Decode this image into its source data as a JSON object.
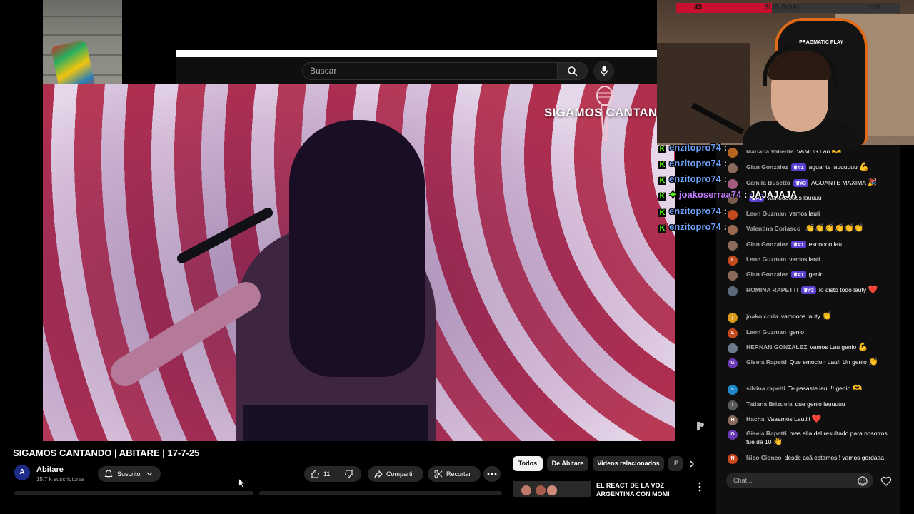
{
  "header": {
    "search_placeholder": "Buscar"
  },
  "video": {
    "overlay_title": "SIGAMOS CANTAN",
    "title": "SIGAMOS CANTANDO | ABITARE | 17-7-25"
  },
  "channel": {
    "avatar_letter": "A",
    "name": "Abitare",
    "subscribers": "15.7 k suscriptores",
    "subscribed_label": "Suscrito"
  },
  "actions": {
    "like_count": "11",
    "share_label": "Compartir",
    "clip_label": "Recortar"
  },
  "chips": [
    "Todos",
    "De Abitare",
    "Videos relacionados",
    "P"
  ],
  "related": {
    "title": "EL REACT DE LA VOZ ARGENTINA CON MOMI"
  },
  "sub_goal": {
    "current": "43",
    "label": "SUB GOAL",
    "target": "100",
    "progress": 0.43
  },
  "streamer": {
    "chair_brand": "PRAGMATIC PLAY"
  },
  "overlay_chat": [
    {
      "user": "enzitopro74",
      "sep": " :",
      "msg": "",
      "plus": false
    },
    {
      "user": "enzitopro74",
      "sep": " :",
      "msg": "",
      "plus": false
    },
    {
      "user": "enzitopro74",
      "sep": " :",
      "msg": "",
      "plus": false
    },
    {
      "user": "joakoserraa74",
      "sep": " :",
      "msg": " JAJAJAJA",
      "plus": true
    },
    {
      "user": "enzitopro74",
      "sep": " :",
      "msg": "",
      "plus": false
    },
    {
      "user": "enzitopro74",
      "sep": " :",
      "msg": "",
      "plus": false
    }
  ],
  "live_chat": [
    {
      "author": "Mariana Valiente",
      "badge": "",
      "text": "VAMOS Lau",
      "emoji": "🫶",
      "avatar_color": "#b5651d",
      "avatar_letter": ""
    },
    {
      "author": "Gian Gonzalez",
      "badge": "#1",
      "text": "aguante lauuuuuu",
      "emoji": "💪",
      "avatar_color": "#8a6a5a",
      "avatar_letter": ""
    },
    {
      "author": "Camila Busetto",
      "badge": "#3",
      "text": "AGUANTE MAXIMA",
      "emoji": "🎉",
      "avatar_color": "#a45a7a",
      "avatar_letter": ""
    },
    {
      "author": "",
      "badge": "#1",
      "text": "vamoooooos lauuuu",
      "emoji": "",
      "avatar_color": "#7a5a4a",
      "avatar_letter": ""
    },
    {
      "author": "Leon Guzman",
      "badge": "",
      "text": "vamos lauti",
      "emoji": "",
      "avatar_color": "#c24a1e",
      "avatar_letter": ""
    },
    {
      "author": "Valentina Coriasco",
      "badge": "",
      "text": "",
      "emoji": "👏👏👏👏👏👏",
      "avatar_color": "#9a6a50",
      "avatar_letter": ""
    },
    {
      "author": "Gian Gonzalez",
      "badge": "#1",
      "text": "esooooo lau",
      "emoji": "",
      "avatar_color": "#8a6a5a",
      "avatar_letter": ""
    },
    {
      "author": "Leon Guzman",
      "badge": "",
      "text": "vamos lauti",
      "emoji": "",
      "avatar_color": "#c24a1e",
      "avatar_letter": "L"
    },
    {
      "author": "Gian Gonzalez",
      "badge": "#1",
      "text": "genio",
      "emoji": "",
      "avatar_color": "#8a6a5a",
      "avatar_letter": ""
    },
    {
      "author": "ROMINA RAPETTI",
      "badge": "#3",
      "text": "lo disto todo lauty",
      "emoji": "❤️",
      "avatar_color": "#5a6a7a",
      "avatar_letter": ""
    },
    {
      "author": "joako coria",
      "badge": "",
      "text": "vamooos lauty",
      "emoji": "👏",
      "avatar_color": "#d99a1a",
      "avatar_letter": "j"
    },
    {
      "author": "Leon Guzman",
      "badge": "",
      "text": "genio",
      "emoji": "",
      "avatar_color": "#c24a1e",
      "avatar_letter": "L"
    },
    {
      "author": "HERNAN GONZALEZ",
      "badge": "",
      "text": "vamos Lau genio",
      "emoji": "💪",
      "avatar_color": "#6a7a8a",
      "avatar_letter": ""
    },
    {
      "author": "Gisela Rapetti",
      "badge": "",
      "text": "Que emocion Lau!! Un genio",
      "emoji": "👏",
      "avatar_color": "#6a3ab5",
      "avatar_letter": "G"
    },
    {
      "author": "silvina rapetti",
      "badge": "",
      "text": "Te pasaste lauu!! genio",
      "emoji": "🫶",
      "avatar_color": "#1e88c9",
      "avatar_letter": "s"
    },
    {
      "author": "Tatiana Brizuela",
      "badge": "",
      "text": "que genio lauuuuu",
      "emoji": "",
      "avatar_color": "#5a5a5a",
      "avatar_letter": "T"
    },
    {
      "author": "Hacha",
      "badge": "",
      "text": "Vaaamos Lautiii",
      "emoji": "❤️",
      "avatar_color": "#8a6a5a",
      "avatar_letter": "H"
    },
    {
      "author": "Gisela Rapetti",
      "badge": "",
      "text": "mas alla del resultado para nosotros fue de 10",
      "emoji": "👋",
      "avatar_color": "#6a3ab5",
      "avatar_letter": "G"
    },
    {
      "author": "Nico Cionco",
      "badge": "",
      "text": "desde acá estamos!! vamos gordaaa",
      "emoji": "",
      "avatar_color": "#c9461e",
      "avatar_letter": "N"
    }
  ],
  "chat_input": {
    "placeholder": "Chat..."
  },
  "colors": {
    "kick_green": "#53fc18",
    "sub_goal_red": "#c8102e",
    "membership_purple": "#5b3fd1"
  }
}
